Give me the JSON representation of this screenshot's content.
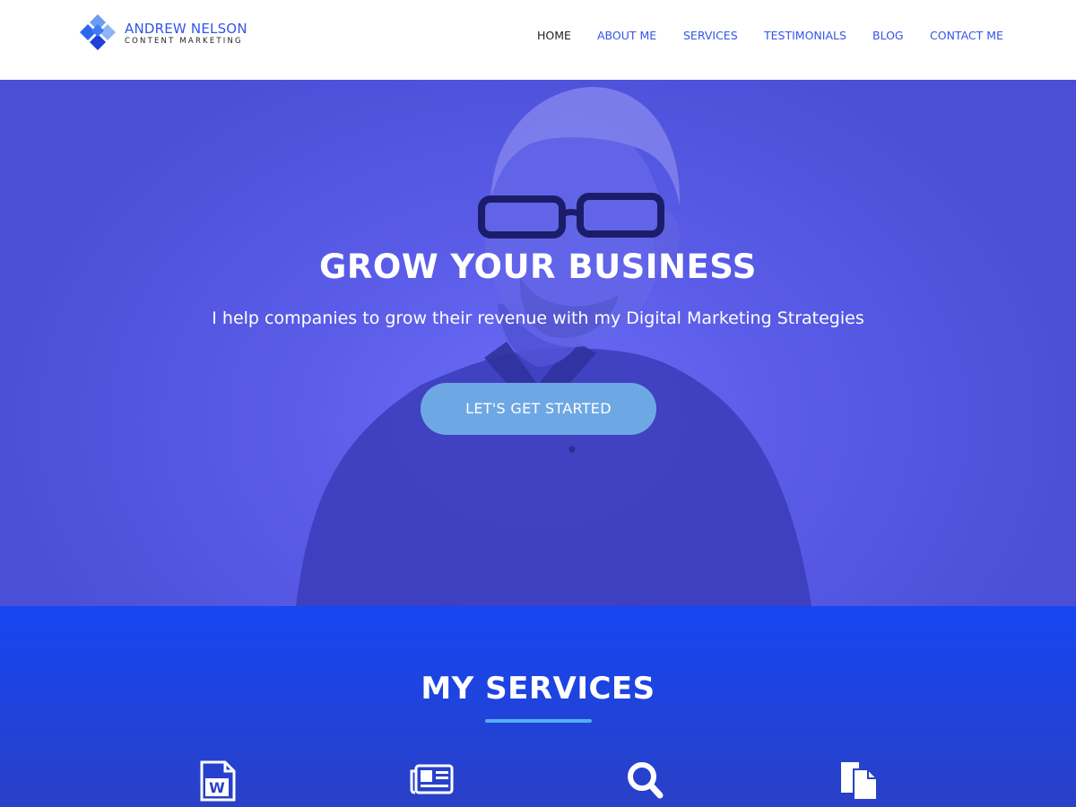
{
  "brand": {
    "name": "ANDREW NELSON",
    "tagline": "CONTENT MARKETING",
    "logo_icon": "diamond-grid-logo",
    "colors": {
      "primary": "#3355e8",
      "light": "#6b9cf3",
      "dark": "#1f3fd6"
    }
  },
  "nav": {
    "items": [
      {
        "label": "HOME",
        "active": true
      },
      {
        "label": "ABOUT ME",
        "active": false
      },
      {
        "label": "SERVICES",
        "active": false
      },
      {
        "label": "TESTIMONIALS",
        "active": false
      },
      {
        "label": "BLOG",
        "active": false
      },
      {
        "label": "CONTACT ME",
        "active": false
      }
    ]
  },
  "hero": {
    "title": "GROW YOUR BUSINESS",
    "subtitle": "I help companies to grow their revenue with my Digital Marketing Strategies",
    "cta_label": "LET'S GET STARTED",
    "overlay_color": "#5a5ce8",
    "cta_color": "#6ea8e4"
  },
  "services": {
    "title": "MY SERVICES",
    "background": "#1546f2",
    "accent": "#55aef0",
    "icons": [
      "word-document-icon",
      "newspaper-icon",
      "search-icon",
      "copy-documents-icon"
    ]
  }
}
